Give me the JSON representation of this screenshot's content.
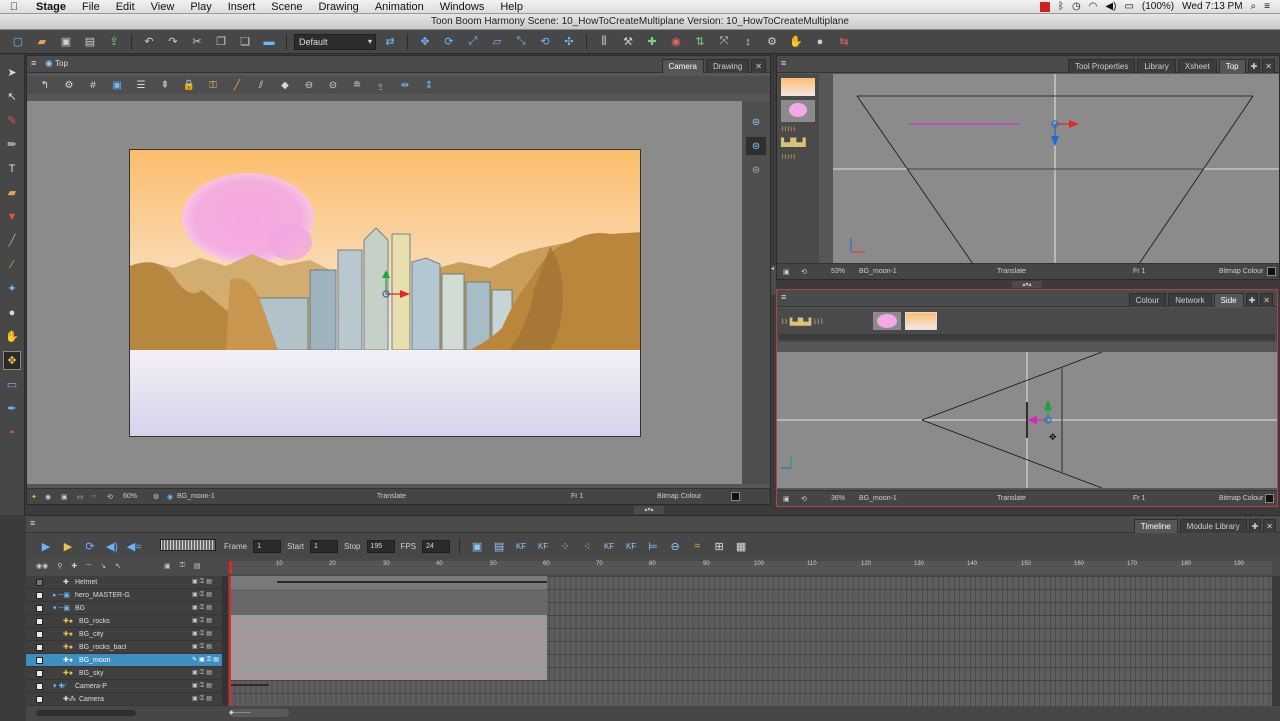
{
  "menubar": {
    "app": "Stage",
    "items": [
      "File",
      "Edit",
      "View",
      "Play",
      "Insert",
      "Scene",
      "Drawing",
      "Animation",
      "Windows",
      "Help"
    ],
    "battery": "(100%)",
    "clock": "Wed 7:13 PM"
  },
  "window": {
    "title": "Toon Boom Harmony Scene: 10_HowToCreateMultiplane Version: 10_HowToCreateMultiplane"
  },
  "toolbar": {
    "workspace_combo": "Default"
  },
  "camera_view": {
    "title": "Top",
    "tabs": [
      "Camera",
      "Drawing"
    ],
    "status": {
      "zoom": "60%",
      "element": "BG_moon-1",
      "mode": "Translate",
      "frame": "Fr 1",
      "colour": "Bitmap Colour"
    }
  },
  "top_view": {
    "tabs": [
      "Tool Properties",
      "Library",
      "Xsheet",
      "Top"
    ],
    "status": {
      "zoom": "53%",
      "element": "BG_moon-1",
      "mode": "Translate",
      "frame": "Fr 1",
      "colour": "Bitmap Colour"
    }
  },
  "side_view": {
    "tabs": [
      "Colour",
      "Network",
      "Side"
    ],
    "status": {
      "zoom": "36%",
      "element": "BG_moon-1",
      "mode": "Translate",
      "frame": "Fr 1",
      "colour": "Bitmap Colour"
    }
  },
  "timeline": {
    "tabs": [
      "Timeline",
      "Module Library"
    ],
    "controls": {
      "frame_label": "Frame",
      "frame_value": "1",
      "start_label": "Start",
      "start_value": "1",
      "stop_label": "Stop",
      "stop_value": "195",
      "fps_label": "FPS",
      "fps_value": "24"
    },
    "ruler_ticks": [
      "10",
      "20",
      "30",
      "40",
      "50",
      "60",
      "70",
      "80",
      "90",
      "100",
      "110",
      "120",
      "130",
      "140",
      "150",
      "160",
      "170",
      "180",
      "190"
    ],
    "layers": [
      {
        "name": "Helmet",
        "checked": false
      },
      {
        "name": "hero_MASTER-G",
        "checked": true
      },
      {
        "name": "BG",
        "checked": true
      },
      {
        "name": "BG_rocks",
        "checked": true
      },
      {
        "name": "BG_city",
        "checked": true
      },
      {
        "name": "BG_rocks_bacl",
        "checked": true
      },
      {
        "name": "BG_moon",
        "checked": true,
        "selected": true
      },
      {
        "name": "BG_sky",
        "checked": true
      },
      {
        "name": "Camera-P",
        "checked": true
      },
      {
        "name": "Camera",
        "checked": true
      }
    ]
  },
  "colors": {
    "selection": "#3d8fbf",
    "accent_blue": "#66b4ff",
    "active_border": "#b84040"
  }
}
